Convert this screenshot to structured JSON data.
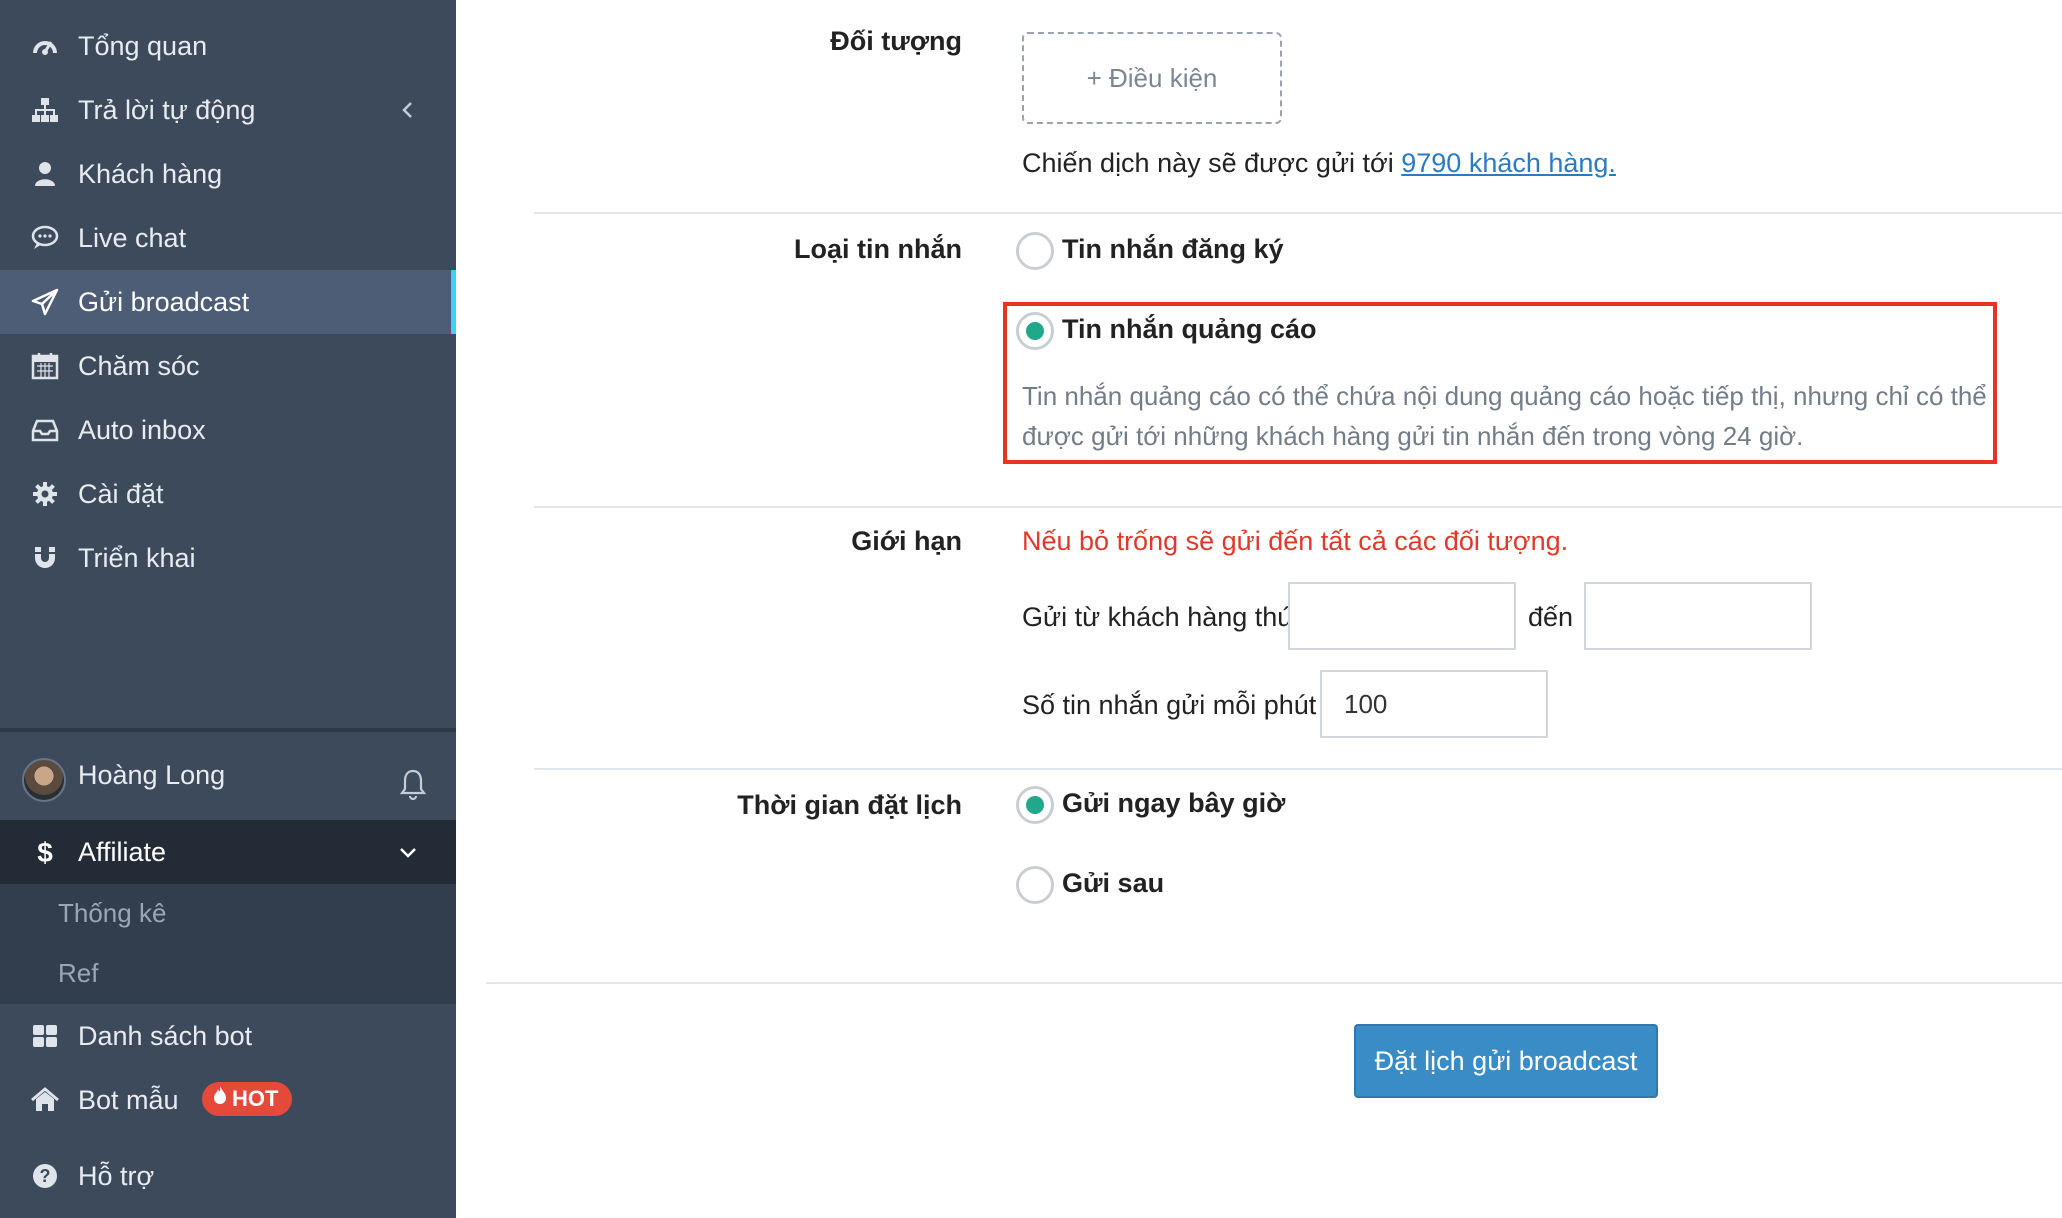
{
  "sidebar": {
    "items": [
      {
        "label": "Tổng quan",
        "icon": "dashboard-icon"
      },
      {
        "label": "Trả lời tự động",
        "icon": "sitemap-icon"
      },
      {
        "label": "Khách hàng",
        "icon": "user-icon"
      },
      {
        "label": "Live chat",
        "icon": "chat-bubble-icon"
      },
      {
        "label": "Gửi broadcast",
        "icon": "paper-plane-icon"
      },
      {
        "label": "Chăm sóc",
        "icon": "calendar-icon"
      },
      {
        "label": "Auto inbox",
        "icon": "inbox-icon"
      },
      {
        "label": "Cài đặt",
        "icon": "gear-icon"
      },
      {
        "label": "Triển khai",
        "icon": "magnet-icon"
      }
    ],
    "active_item": "Gửi broadcast",
    "user": {
      "name": "Hoàng Long"
    },
    "affiliate": {
      "label": "Affiliate",
      "sub_items": [
        "Thống kê",
        "Ref"
      ]
    },
    "bottom_items": [
      {
        "label": "Danh sách bot",
        "icon": "grid-icon"
      },
      {
        "label": "Bot mẫu",
        "icon": "home-icon",
        "badge": "HOT"
      },
      {
        "label": "Hỗ trợ",
        "icon": "question-circle-icon"
      }
    ],
    "accent_color": "#3fd0f0"
  },
  "form": {
    "audience": {
      "label": "Đối tượng",
      "condition_button": "+ Điều kiện",
      "campaign_prefix": "Chiến dịch này sẽ được gửi tới",
      "campaign_link": "9790 khách hàng."
    },
    "message_type": {
      "label": "Loại tin nhắn",
      "options": [
        {
          "label": "Tin nhắn đăng ký",
          "checked": false
        },
        {
          "label": "Tin nhắn quảng cáo",
          "checked": true
        }
      ],
      "description": "Tin nhắn quảng cáo có thể chứa nội dung quảng cáo hoặc tiếp thị, nhưng chỉ có thể được gửi tới những khách hàng gửi tin nhắn đến trong vòng 24 giờ."
    },
    "limit": {
      "label": "Giới hạn",
      "warning": "Nếu bỏ trống sẽ gửi đến tất cả các đối tượng.",
      "from_label": "Gửi từ khách hàng thứ",
      "from_value": "",
      "to_label": "đến",
      "to_value": "",
      "rate_label": "Số tin nhắn gửi mỗi phút",
      "rate_value": "100"
    },
    "schedule": {
      "label": "Thời gian đặt lịch",
      "options": [
        {
          "label": "Gửi ngay bây giờ",
          "checked": true
        },
        {
          "label": "Gửi sau",
          "checked": false
        }
      ]
    },
    "submit_label": "Đặt lịch gửi broadcast"
  },
  "colors": {
    "sidebar_bg": "#3d4a5c",
    "radio_checked": "#1fa88a",
    "warning": "#e0392a",
    "highlight_border": "#e53422",
    "primary_button": "#3a8cc6",
    "link": "#2b7bc4"
  }
}
